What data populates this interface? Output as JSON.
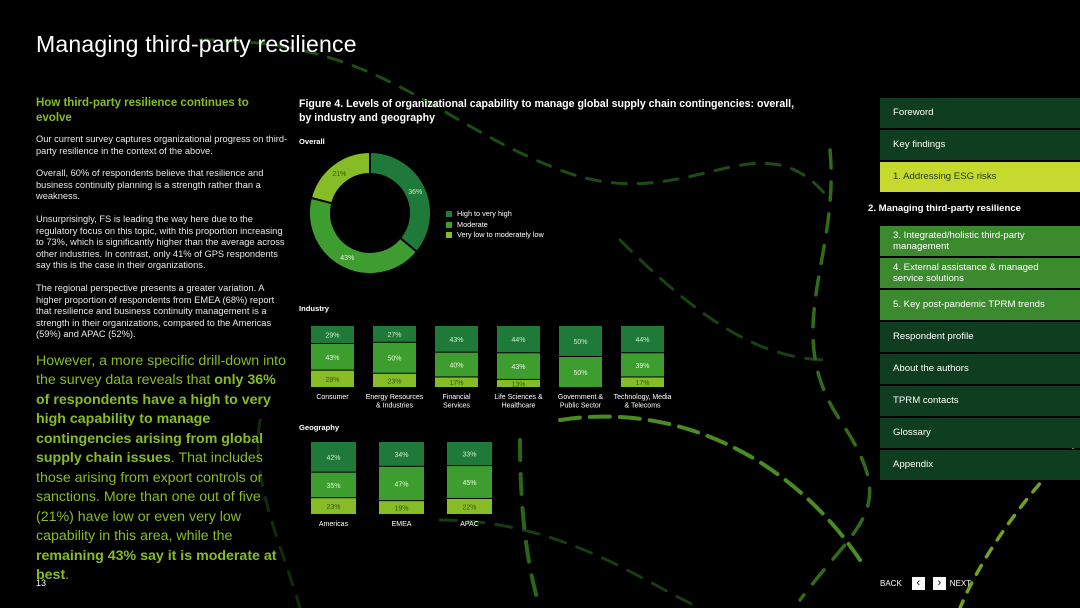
{
  "page": {
    "title": "Managing third-party resilience",
    "page_number": "13"
  },
  "left": {
    "heading": "How third-party resilience continues to evolve",
    "paragraphs": [
      "Our current survey captures organizational progress on third-party resilience in the context of the above.",
      "Overall, 60% of respondents believe that resilience and business continuity planning is a strength rather than a weakness.",
      "Unsurprisingly, FS is leading the way here due to the regulatory focus on this topic, with this proportion increasing to 73%, which is significantly higher than the average across other industries. In contrast, only 41% of GPS respondents say this is the case in their organizations.",
      "The regional perspective presents a greater variation. A higher proportion of respondents from EMEA (68%) report that resilience and business continuity management is a strength in their organizations, compared to the Americas (59%) and APAC (52%)."
    ],
    "pull": {
      "p1": "However, a more specific drill-down into the survey data reveals that ",
      "p2": "only 36% of respondents have a high to very high capability to manage contingencies arising from global supply chain issues",
      "p3": ". That includes those arising from export controls or sanctions. More than one out of five (21%) have low or even very low capability in this area, while the ",
      "p4": "remaining 43% say it is moderate at best",
      "p5": "."
    }
  },
  "figure": {
    "title": "Figure 4. Levels of organizational capability to manage global supply chain contingencies: overall, by industry and geography",
    "overall_label": "Overall",
    "industry_label": "Industry",
    "geography_label": "Geography",
    "legend": [
      {
        "label": "High to very high",
        "color": "#1f7a3a"
      },
      {
        "label": "Moderate",
        "color": "#3d9e2f"
      },
      {
        "label": "Very low to moderately low",
        "color": "#86bc25"
      }
    ]
  },
  "chart_data": [
    {
      "type": "pie",
      "title": "Overall",
      "series": [
        {
          "name": "High to very high",
          "value": 36,
          "label": "36%"
        },
        {
          "name": "Moderate",
          "value": 43,
          "label": "43%"
        },
        {
          "name": "Very low to moderately low",
          "value": 21,
          "label": "21%"
        }
      ]
    },
    {
      "type": "bar",
      "title": "Industry",
      "stacked": true,
      "categories": [
        "Consumer",
        "Energy Resources & Industries",
        "Financial Services",
        "Life Sciences & Healthcare",
        "Government & Public Sector",
        "Technology, Media & Telecoms"
      ],
      "category_lines": [
        [
          "Consumer"
        ],
        [
          "Energy Resources",
          "& Industries"
        ],
        [
          "Financial",
          "Services"
        ],
        [
          "Life Sciences &",
          "Healthcare"
        ],
        [
          "Government &",
          "Public Sector"
        ],
        [
          "Technology, Media",
          "& Telecoms"
        ]
      ],
      "series": [
        {
          "name": "High to very high",
          "values": [
            29,
            27,
            43,
            44,
            50,
            44
          ]
        },
        {
          "name": "Moderate",
          "values": [
            43,
            50,
            40,
            43,
            50,
            39
          ]
        },
        {
          "name": "Very low to moderately low",
          "values": [
            28,
            23,
            17,
            13,
            0,
            17
          ]
        }
      ]
    },
    {
      "type": "bar",
      "title": "Geography",
      "stacked": true,
      "categories": [
        "Americas",
        "EMEA",
        "APAC"
      ],
      "series": [
        {
          "name": "High to very high",
          "values": [
            42,
            34,
            33
          ]
        },
        {
          "name": "Moderate",
          "values": [
            35,
            47,
            45
          ]
        },
        {
          "name": "Very low to moderately low",
          "values": [
            23,
            19,
            22
          ]
        }
      ]
    }
  ],
  "nav": {
    "items": [
      {
        "label": "Foreword",
        "style": "dark"
      },
      {
        "label": "Key findings",
        "style": "dark"
      },
      {
        "label": "1.  Addressing ESG risks",
        "style": "yellow"
      },
      {
        "label": "2.  Managing third-party resilience",
        "style": "active"
      },
      {
        "label": "3.  Integrated/holistic third-party management",
        "style": "l2"
      },
      {
        "label": "4.  External assistance & managed service solutions",
        "style": "l2"
      },
      {
        "label": "5.  Key post-pandemic TPRM trends",
        "style": "l2"
      },
      {
        "label": "Respondent profile",
        "style": "dark"
      },
      {
        "label": "About the authors",
        "style": "dark"
      },
      {
        "label": "TPRM contacts",
        "style": "dark"
      },
      {
        "label": "Glossary",
        "style": "dark"
      },
      {
        "label": "Appendix",
        "style": "dark"
      }
    ]
  },
  "pager": {
    "back_label": "BACK",
    "next_label": "NEXT",
    "back_icon": "chevron-left-icon",
    "next_icon": "chevron-right-icon"
  }
}
